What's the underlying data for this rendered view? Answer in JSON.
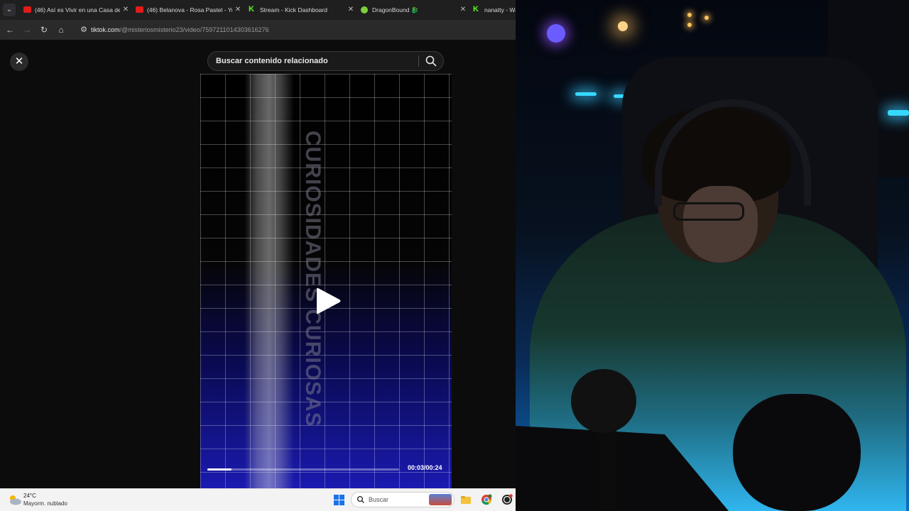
{
  "browser": {
    "tabs": [
      {
        "title": "(46) Así es Vivir en una Casa de",
        "favicon": "youtube-favicon"
      },
      {
        "title": "(46) Belanova - Rosa Pastel - Yo",
        "favicon": "youtube-favicon"
      },
      {
        "title": "Stream - Kick Dashboard",
        "favicon": "kick-favicon"
      },
      {
        "title": "DragonBound 🐉",
        "favicon": "dragonbound-favicon"
      },
      {
        "title": "nanatty - Wa",
        "favicon": "kick-favicon"
      }
    ],
    "address": {
      "host": "tiktok.com",
      "path": "/@misteriosmisterio23/video/7597211014303616276"
    }
  },
  "tiktok": {
    "search_placeholder": "Buscar contenido relacionado",
    "video_overlay_text": "CURIOSIDADES CURIOSAS",
    "time_display": "00:03/00:24",
    "progress_fraction": 0.125
  },
  "taskbar": {
    "weather_temp": "24°C",
    "weather_desc": "Mayorm. nublado",
    "search_label": "Buscar"
  },
  "colors": {
    "tabbar": "#1f1f1f",
    "toolbar": "#2a2a2a",
    "kick_green": "#53fc18",
    "youtube_red": "#e21b1b",
    "windows_blue": "#1a73e8",
    "led_cyan": "#37d8ff"
  }
}
